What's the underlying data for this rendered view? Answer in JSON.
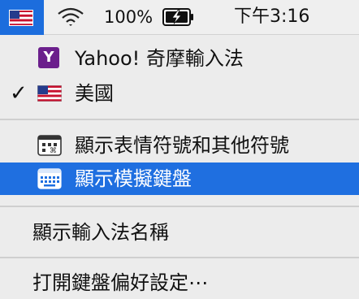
{
  "menubar": {
    "flag_icon": "us-flag-icon",
    "wifi_icon": "wifi-icon",
    "battery_percent": "100%",
    "battery_icon": "battery-charging-icon",
    "clock": "下午3:16",
    "accent_color": "#1c6ddd"
  },
  "menu": {
    "input_sources": [
      {
        "label": "Yahoo! 奇摩輸入法",
        "icon": "yahoo-icon",
        "checked": false
      },
      {
        "label": "美國",
        "icon": "us-flag-icon",
        "checked": true
      }
    ],
    "emoji_item": {
      "label": "顯示表情符號和其他符號",
      "icon": "emoji-viewer-icon"
    },
    "keyboard_viewer_item": {
      "label": "顯示模擬鍵盤",
      "icon": "keyboard-viewer-icon",
      "selected": true
    },
    "show_name_item": {
      "label": "顯示輸入法名稱"
    },
    "open_prefs_item": {
      "label": "打開鍵盤偏好設定⋯"
    },
    "selection_color": "#1f6fe0"
  }
}
